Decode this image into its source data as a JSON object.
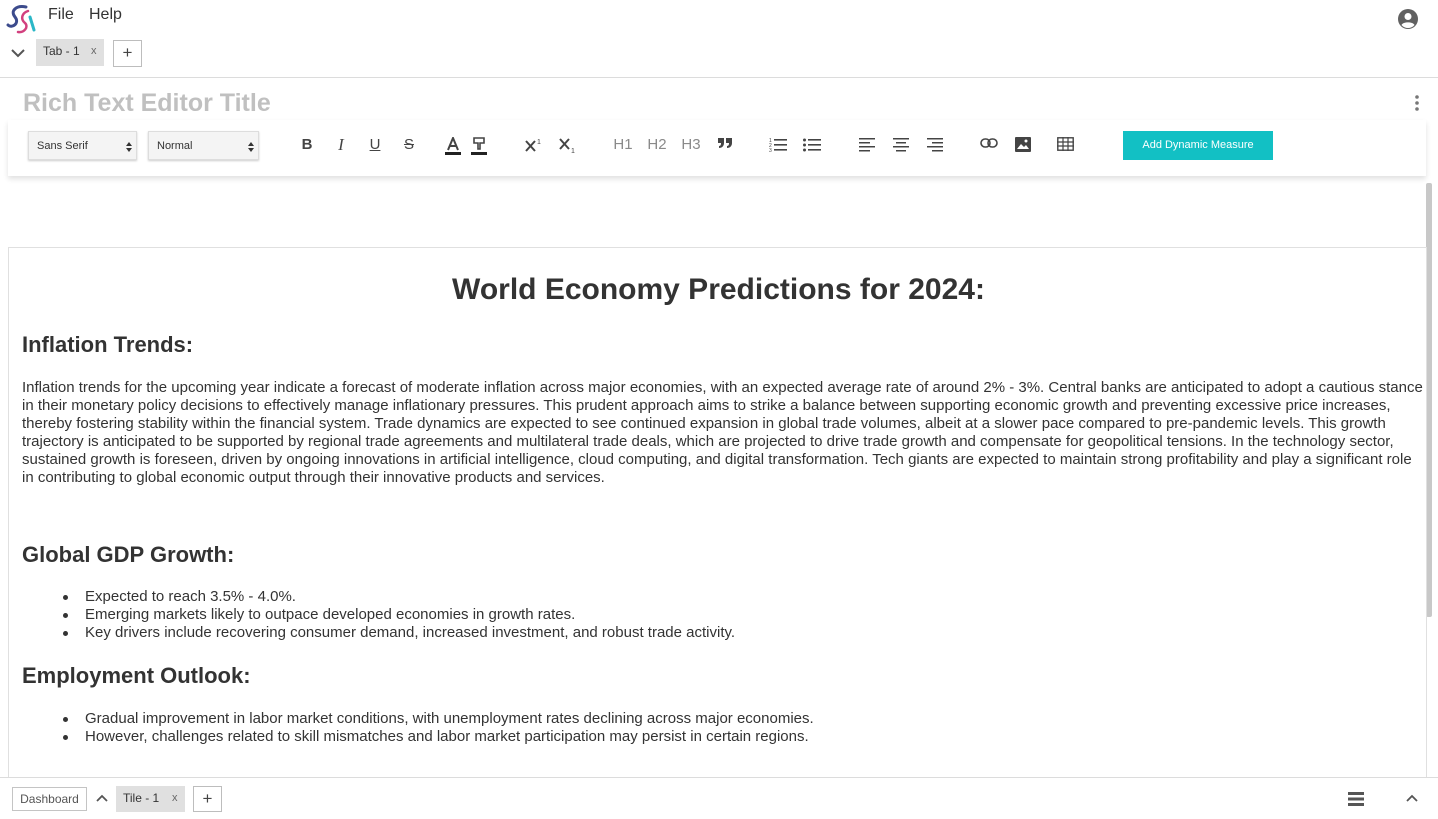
{
  "menubar": {
    "logo_icon": "app-logo-icon",
    "items": [
      {
        "label": "File"
      },
      {
        "label": "Help"
      }
    ],
    "user_icon": "account-circle-icon"
  },
  "tabs": {
    "items": [
      {
        "label": "Tab - 1",
        "close": "x"
      }
    ],
    "add_label": "+"
  },
  "editor": {
    "title_placeholder": "Rich Text Editor Title",
    "toolbar": {
      "font_select": "Sans Serif",
      "size_select": "Normal",
      "buttons": {
        "bold": "B",
        "italic": "I",
        "underline": "U",
        "strike": "S",
        "h1": "H1",
        "h2": "H2",
        "h3": "H3"
      },
      "add_measure_label": "Add Dynamic Measure",
      "accent_color": "#12c0c4"
    }
  },
  "document": {
    "title": "World Economy Predictions for 2024:",
    "sections": [
      {
        "heading": "Inflation Trends:",
        "paragraph": "Inflation trends for the upcoming year indicate a forecast of moderate inflation across major economies, with an expected average rate of around 2% - 3%. Central banks are anticipated to adopt a cautious stance in their monetary policy decisions to effectively manage inflationary pressures. This prudent approach aims to strike a balance between supporting economic growth and preventing excessive price increases, thereby fostering stability within the financial system. Trade dynamics are expected to see continued expansion in global trade volumes, albeit at a slower pace compared to pre-pandemic levels. This growth trajectory is anticipated to be supported by regional trade agreements and multilateral trade deals, which are projected to drive trade growth and compensate for geopolitical tensions. In the technology sector, sustained growth is foreseen, driven by ongoing innovations in artificial intelligence, cloud computing, and digital transformation. Tech giants are expected to maintain strong profitability and play a significant role in contributing to global economic output through their innovative products and services."
      },
      {
        "heading": "Global GDP Growth:",
        "bullets": [
          "Expected to reach 3.5% - 4.0%.",
          "Emerging markets likely to outpace developed economies in growth rates.",
          "Key drivers include recovering consumer demand, increased investment, and robust trade activity."
        ]
      },
      {
        "heading": "Employment Outlook:",
        "bullets": [
          "Gradual improvement in labor market conditions, with unemployment rates declining across major economies.",
          "However, challenges related to skill mismatches and labor market participation may persist in certain regions."
        ]
      }
    ]
  },
  "bottombar": {
    "dashboard_label": "Dashboard",
    "tile_tab": {
      "label": "Tile - 1",
      "close": "x"
    },
    "add_label": "+"
  }
}
